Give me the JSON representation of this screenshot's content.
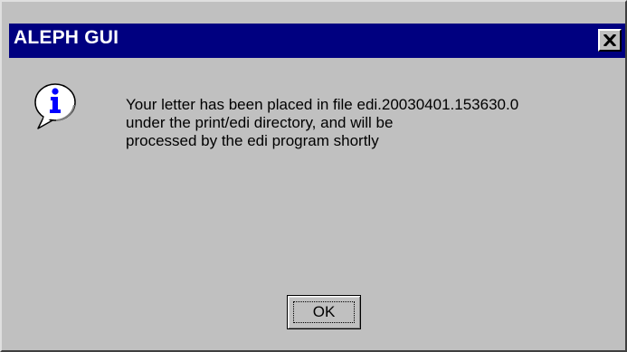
{
  "dialog": {
    "title": "ALEPH GUI",
    "close_icon": "close-icon",
    "icon": "information-icon",
    "message_lines": [
      "Your letter has been placed in file edi.20030401.153630.0",
      "under the print/edi directory, and will be",
      "processed by the edi program shortly"
    ],
    "ok_label": "OK"
  },
  "colors": {
    "titlebar": "#000080",
    "face": "#c0c0c0",
    "title_text": "#ffffff"
  }
}
